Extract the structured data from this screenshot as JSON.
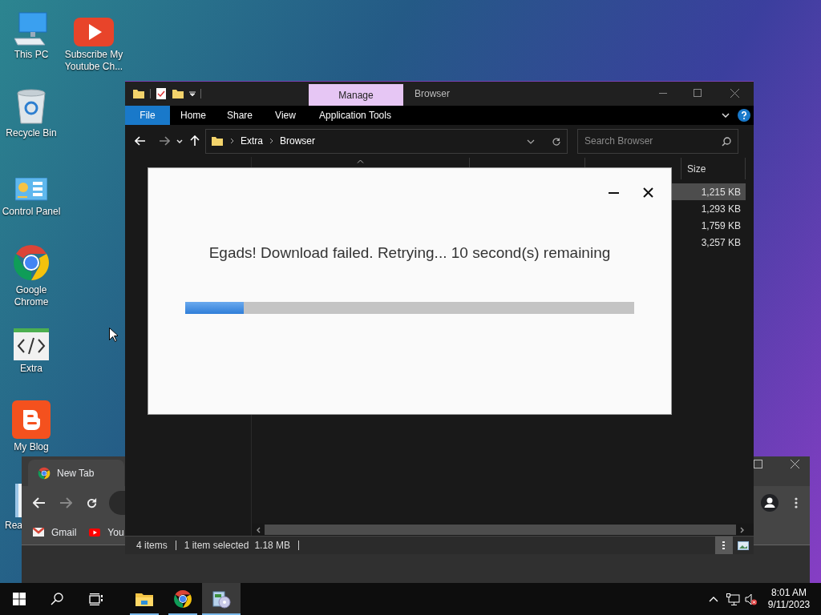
{
  "desktop": {
    "left_column": [
      {
        "label": "This PC",
        "kind": "pc"
      },
      {
        "label": "Recycle Bin",
        "kind": "recycle"
      },
      {
        "label": "Control Panel",
        "kind": "control"
      },
      {
        "label": "Google Chrome",
        "kind": "chrome"
      },
      {
        "label": "Extra",
        "kind": "code"
      },
      {
        "label": "My Blog",
        "kind": "blogger"
      },
      {
        "label": "Rea",
        "kind": "doc"
      }
    ],
    "right_column": [
      {
        "label": "Subscribe My Youtube Ch...",
        "kind": "youtube"
      }
    ]
  },
  "chrome_window": {
    "tab": "New Tab",
    "bookmarks": [
      {
        "label": "Gmail",
        "kind": "gmail"
      },
      {
        "label": "You",
        "kind": "youtube"
      }
    ]
  },
  "explorer": {
    "context_tab": "Manage",
    "title": "Browser",
    "ribbon": {
      "file": "File",
      "tabs": [
        "Home",
        "Share",
        "View",
        "Application Tools"
      ]
    },
    "breadcrumb": [
      "Extra",
      "Browser"
    ],
    "search": {
      "placeholder": "Search Browser"
    },
    "size_column": "Size",
    "rows": [
      {
        "size": "1,215 KB",
        "selected": true
      },
      {
        "size": "1,293 KB",
        "selected": false
      },
      {
        "size": "1,759 KB",
        "selected": false
      },
      {
        "size": "3,257 KB",
        "selected": false
      }
    ],
    "status": {
      "items": "4 items",
      "selection": "1 item selected",
      "size": "1.18 MB"
    }
  },
  "dialog": {
    "message": "Egads! Download failed. Retrying... 10 second(s) remaining",
    "level": 0.13
  },
  "taskbar": {
    "apps": [
      {
        "kind": "explorer",
        "selected": false
      },
      {
        "kind": "chrome",
        "selected": false
      },
      {
        "kind": "installer",
        "selected": true
      }
    ],
    "time": "8:01 AM",
    "date": "9/11/2023"
  }
}
